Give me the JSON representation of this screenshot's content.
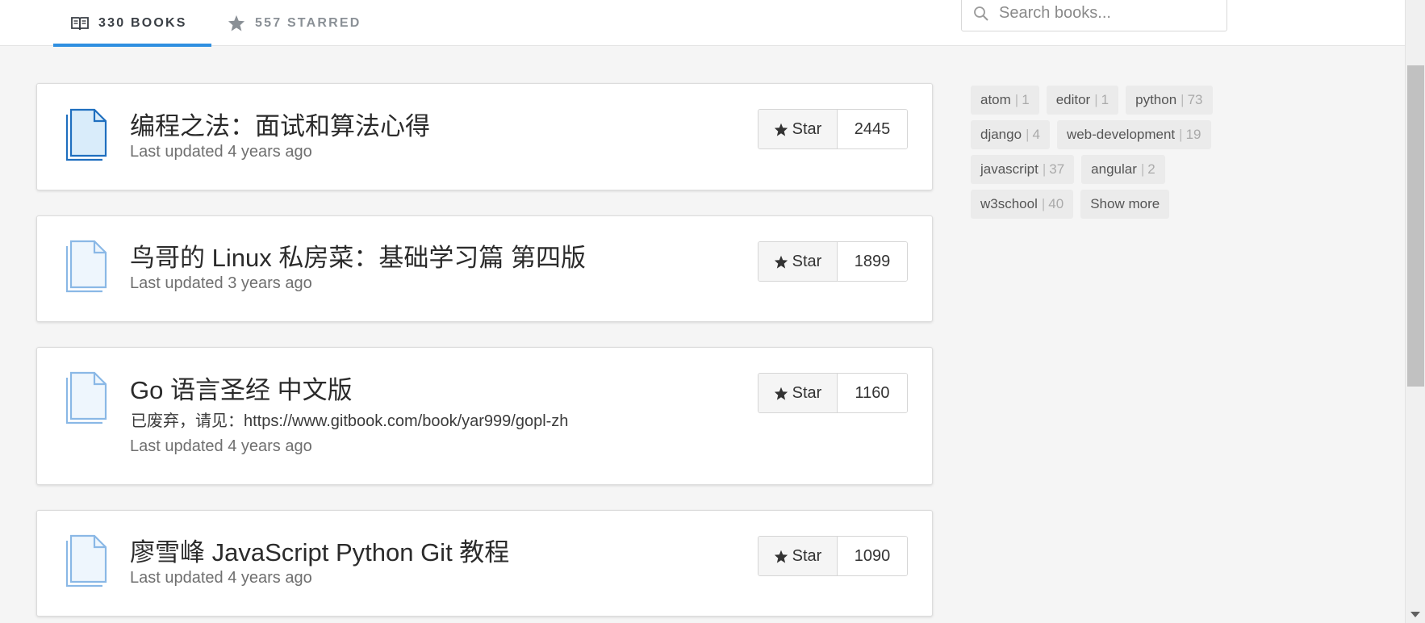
{
  "tabs": {
    "books": "330 BOOKS",
    "starred": "557 STARRED"
  },
  "search": {
    "placeholder": "Search books..."
  },
  "books": [
    {
      "title": "编程之法：面试和算法心得",
      "description": "",
      "updated": "Last updated 4 years ago",
      "star_label": "Star",
      "stars": "2445",
      "icon": "book-dark-icon"
    },
    {
      "title": "鸟哥的 Linux 私房菜：基础学习篇 第四版",
      "description": "",
      "updated": "Last updated 3 years ago",
      "star_label": "Star",
      "stars": "1899",
      "icon": "book-light-icon"
    },
    {
      "title": "Go 语言圣经 中文版",
      "description": "已废弃，请见：https://www.gitbook.com/book/yar999/gopl-zh",
      "updated": "Last updated 4 years ago",
      "star_label": "Star",
      "stars": "1160",
      "icon": "book-light-icon"
    },
    {
      "title": "廖雪峰 JavaScript Python Git 教程",
      "description": "",
      "updated": "Last updated 4 years ago",
      "star_label": "Star",
      "stars": "1090",
      "icon": "book-light-icon"
    }
  ],
  "tags": [
    {
      "name": "atom",
      "count": "1"
    },
    {
      "name": "editor",
      "count": "1"
    },
    {
      "name": "python",
      "count": "73"
    },
    {
      "name": "django",
      "count": "4"
    },
    {
      "name": "web-development",
      "count": "19"
    },
    {
      "name": "javascript",
      "count": "37"
    },
    {
      "name": "angular",
      "count": "2"
    },
    {
      "name": "w3school",
      "count": "40"
    }
  ],
  "show_more": "Show more",
  "colors": {
    "accent": "#2f8fe0",
    "book_icon_dark": "#1f6fbf",
    "book_icon_light": "#8ab8e6"
  }
}
